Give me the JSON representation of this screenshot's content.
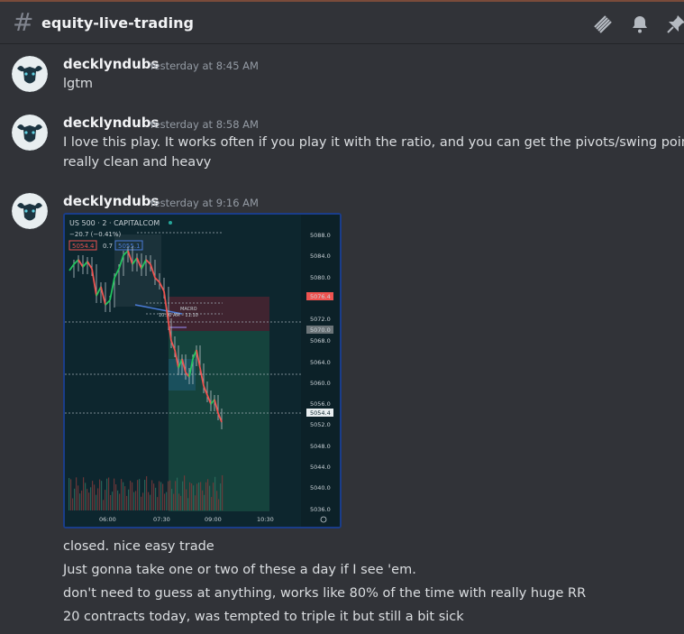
{
  "header": {
    "channel_name": "equity-live-trading",
    "hash_symbol": "#",
    "icons": [
      "threads-icon",
      "bell-icon",
      "pin-icon"
    ]
  },
  "messages": [
    {
      "username": "decklyndubs",
      "timestamp": "Yesterday at 8:45 AM",
      "lines": [
        "lgtm"
      ]
    },
    {
      "username": "decklyndubs",
      "timestamp": "Yesterday at 8:58 AM",
      "lines": [
        "I love this play. It works often if you play it with the ratio, and you can get the pivots/swing points",
        "really clean and heavy"
      ]
    },
    {
      "username": "decklyndubs",
      "timestamp": "Yesterday at 9:16 AM",
      "lines": []
    }
  ],
  "followups": [
    "closed. nice easy trade",
    "Just gonna take one or two of these a day if I see 'em.",
    "don't need to guess at anything, works like 80% of the time with really huge RR",
    "20 contracts today, was tempted to triple it but still a bit sick"
  ],
  "chart": {
    "symbol": "US 500 · 2 · CAPITALCOM",
    "change": "−20.7 (−0.41%)",
    "sell_price": "5054.4",
    "spread": "0.7",
    "buy_price": "5055.1",
    "session_label": "MACRO",
    "session_time": "10:50 AM – 11:10",
    "price_labels": [
      "5088.0",
      "5084.0",
      "5080.0",
      "5076.4",
      "5072.0",
      "5070.0",
      "5068.0",
      "5064.0",
      "5060.0",
      "5056.0",
      "5054.4",
      "5052.0",
      "5048.0",
      "5044.0",
      "5040.0",
      "5036.0"
    ],
    "time_labels": [
      "06:00",
      "07:30",
      "09:00",
      "10:30"
    ],
    "colors": {
      "up": "#26a69a",
      "down": "#ef5350",
      "stop_zone": "#5a2a35",
      "target_zone": "#1f5a52"
    }
  }
}
